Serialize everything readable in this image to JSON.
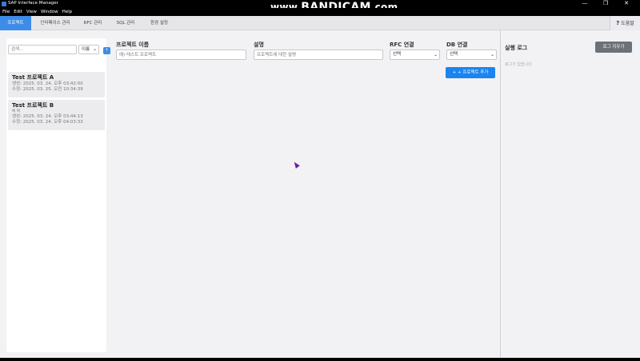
{
  "window": {
    "title": "SAP Interface Manager",
    "controls": [
      "—",
      "❐",
      "✕"
    ]
  },
  "watermark": {
    "prefix": "www.",
    "brand": "BANDICAM",
    "suffix": ".com"
  },
  "menu": [
    "File",
    "Edit",
    "View",
    "Window",
    "Help"
  ],
  "tabs": [
    "프로젝트",
    "인터페이스 관리",
    "RFC 관리",
    "SQL 관리",
    "환경 설정"
  ],
  "help": {
    "icon": "?",
    "label": "도움말"
  },
  "sidebar": {
    "search_placeholder": "검색...",
    "sort_value": "이름",
    "sort_dir": "↑",
    "projects": [
      {
        "name": "Test 프로젝트 A",
        "description": "",
        "created": "생성: 2025. 03. 24. 오후 03:42:00",
        "modified": "수정: 2025. 03. 25. 오전 10:34:39"
      },
      {
        "name": "Test 프로젝트 B",
        "description": "예 제",
        "created": "생성: 2025. 03. 24. 오후 03:44:13",
        "modified": "수정: 2025. 03. 24. 오후 04:03:33"
      }
    ]
  },
  "form": {
    "name_label": "프로젝트 이름",
    "name_placeholder": "예) 테스트 프로젝트",
    "desc_label": "설명",
    "desc_placeholder": "프로젝트에 대한 설명",
    "rfc_label": "RFC 연결",
    "rfc_value": "선택",
    "db_label": "DB 연결",
    "db_value": "선택",
    "add_button": "+ 프로젝트 추가"
  },
  "log": {
    "title": "실행 로그",
    "clear_button": "로그 지우기",
    "empty_text": "로그가 없습니다."
  },
  "colors": {
    "accent": "#3d8de8",
    "primary_button": "#1a84f0",
    "secondary_button": "#6d7278",
    "cursor": "#6b1fa0"
  }
}
